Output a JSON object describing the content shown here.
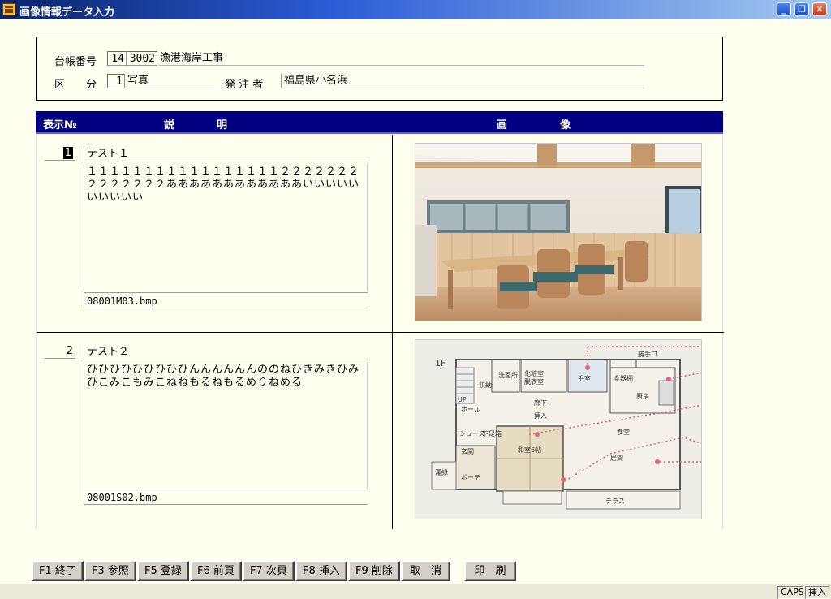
{
  "window": {
    "title": "画像情報データ入力",
    "minimize": "_",
    "restore": "❐",
    "close": "✕"
  },
  "header": {
    "ledger_label": "台帳番号",
    "ledger_prefix": "14",
    "ledger_number": "3002",
    "project_name": "漁港海岸工事",
    "category_label": "区　　分",
    "category_code": "1",
    "category_name": "写真",
    "client_label": "発 注 者",
    "client_name": "福島県小名浜"
  },
  "table": {
    "col_no": "表示№",
    "col_desc": "説　　　　明",
    "col_image": "画　　　　　像"
  },
  "records": [
    {
      "no": "1",
      "title": "テスト１",
      "description": "１１１１１１１１１１１１１１１１１２２２２２２２２２２２２２２ああああああああああああいいいいいいいいいい",
      "filename": "08001M03.bmp",
      "image": "dining-room-photo"
    },
    {
      "no": "2",
      "title": "テスト２",
      "description": "ひひひひひひひひひんんんんんんののねひきみきひみひこみこもみこねねもるねもるめりねめる",
      "filename": "08001S02.bmp",
      "image": "floor-plan",
      "plan": {
        "floor": "1F",
        "rooms": [
          "勝手口",
          "浴室",
          "洗面所",
          "化粧室",
          "脱衣室",
          "収納",
          "廊下",
          "食器棚",
          "厨房",
          "ホール",
          "挿入",
          "食堂",
          "和室6帖",
          "居間",
          "ポーチ",
          "玄関",
          "テラス",
          "下足箱",
          "シューズ",
          "UP",
          "濡縁"
        ]
      }
    }
  ],
  "buttons": [
    {
      "label": "F1 終了"
    },
    {
      "label": "F3 参照"
    },
    {
      "label": "F5 登録"
    },
    {
      "label": "F6 前頁"
    },
    {
      "label": "F7 次頁"
    },
    {
      "label": "F8 挿入"
    },
    {
      "label": "F9 削除"
    },
    {
      "label": "取　消"
    },
    {
      "label": "印　刷"
    }
  ],
  "status": {
    "caps": "CAPS",
    "mode": "挿入"
  }
}
